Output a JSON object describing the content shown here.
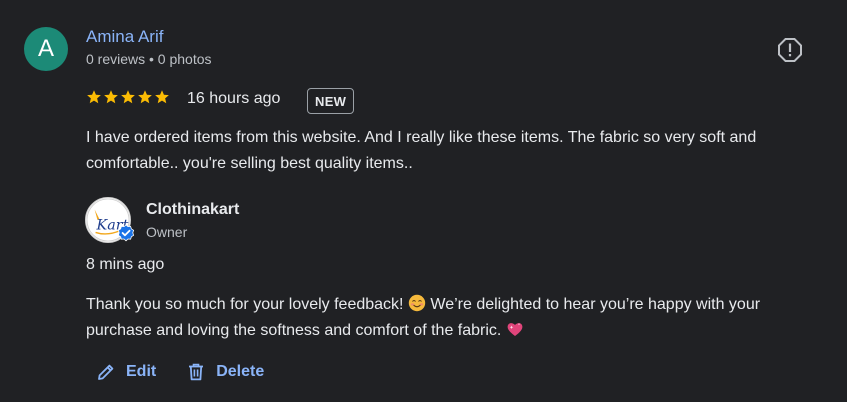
{
  "colors": {
    "background": "#202124",
    "link": "#8ab4f8",
    "star": "#fbbc04",
    "avatar_bg": "#1c8a77",
    "verified": "#1a73e8",
    "text_primary": "#e8eaed",
    "text_secondary": "#bdc1c6"
  },
  "review": {
    "avatar_letter": "A",
    "reviewer_name": "Amina Arif",
    "reviewer_meta": "0 reviews • 0 photos",
    "rating": 5,
    "time": "16 hours ago",
    "badge": "NEW",
    "text": "I have ordered items from this website. And I really like these items. The fabric so very soft and comfortable.. you're selling best quality items..",
    "report_icon": "report-icon"
  },
  "reply": {
    "logo_icon": "clothinakart-logo",
    "logo_text": "Kart",
    "verified_icon": "verified-check-icon",
    "owner_name": "Clothinakart",
    "owner_role": "Owner",
    "time": "8 mins ago",
    "text_part1": "Thank you so much for your lovely feedback! ",
    "emoji1": "smiling-face-emoji",
    "text_part2": " We’re delighted to hear you’re happy with your purchase and loving the softness and comfort of the fabric. ",
    "emoji2": "sparkling-heart-emoji"
  },
  "actions": {
    "edit_label": "Edit",
    "edit_icon": "pencil-icon",
    "delete_label": "Delete",
    "delete_icon": "trash-icon"
  }
}
